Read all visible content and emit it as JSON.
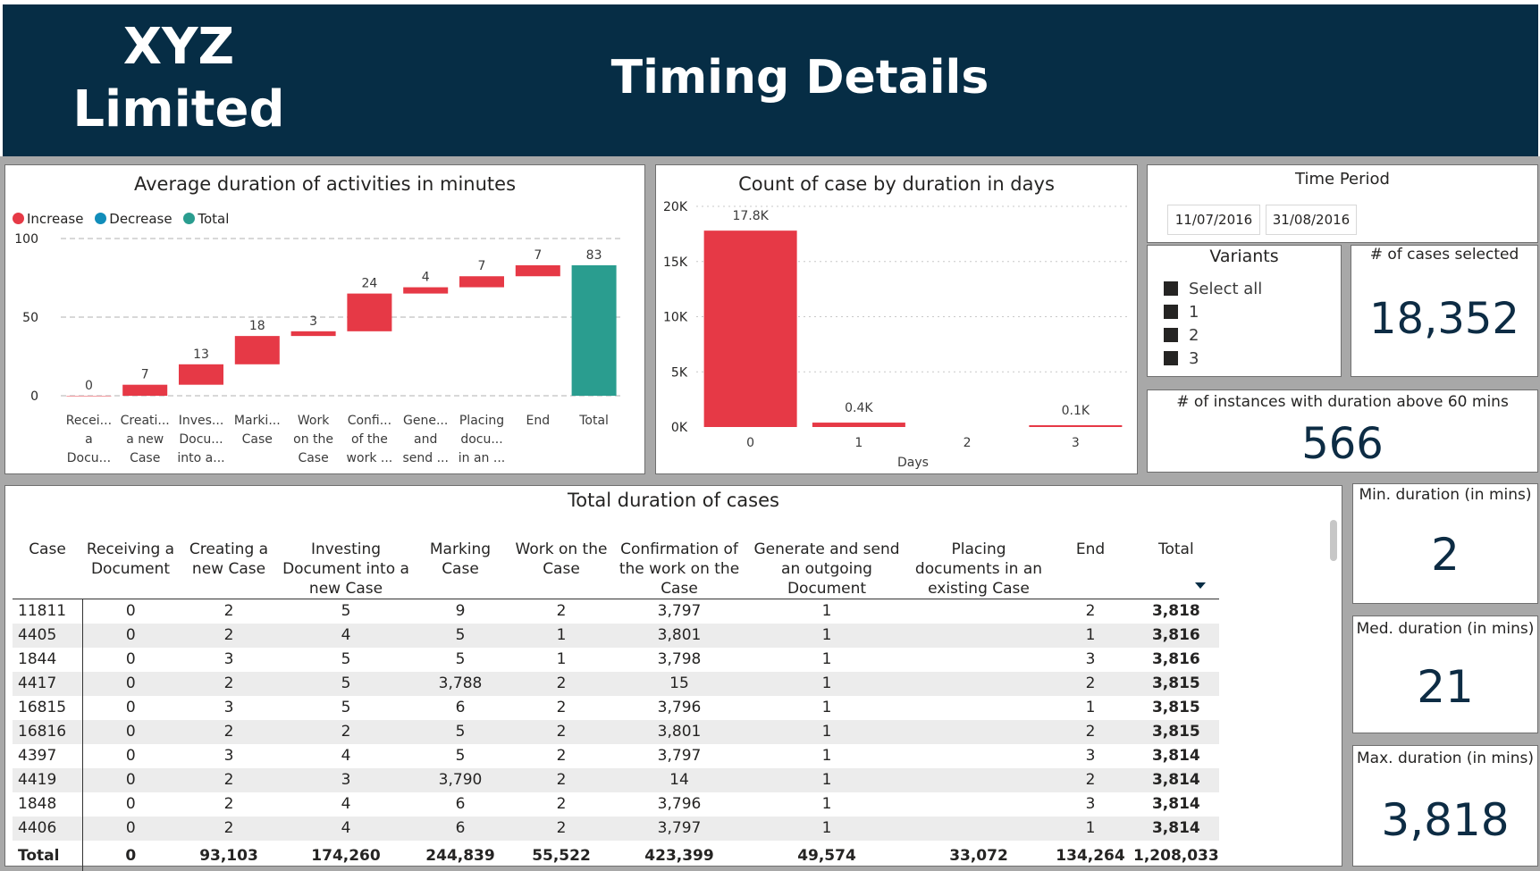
{
  "header": {
    "brand_line1": "XYZ",
    "brand_line2": "Limited",
    "title": "Timing Details"
  },
  "colors": {
    "increase": "#e63946",
    "decrease": "#118dba",
    "total": "#2a9d8f",
    "header_bg": "#062d45"
  },
  "waterfall": {
    "title": "Average duration of activities in minutes",
    "legend": [
      "Increase",
      "Decrease",
      "Total"
    ],
    "yticks": [
      "100",
      "50",
      "0"
    ]
  },
  "histogram": {
    "title": "Count of case by duration in days",
    "xlabel": "Days",
    "yticks": [
      "20K",
      "15K",
      "10K",
      "5K",
      "0K"
    ]
  },
  "chart_data": [
    {
      "type": "bar",
      "subtype": "waterfall",
      "title": "Average duration of activities in minutes",
      "categories": [
        [
          "Recei...",
          "a",
          "Docu..."
        ],
        [
          "Creati...",
          "a new",
          "Case"
        ],
        [
          "Inves...",
          "Docu...",
          "into a..."
        ],
        [
          "Marki...",
          "Case"
        ],
        [
          "Work",
          "on the",
          "Case"
        ],
        [
          "Confi...",
          "of the",
          "work ..."
        ],
        [
          "Gene...",
          "and",
          "send ..."
        ],
        [
          "Placing",
          "docu...",
          "in an ..."
        ],
        [
          "End"
        ],
        [
          "Total"
        ]
      ],
      "values": [
        0,
        7,
        13,
        18,
        3,
        24,
        4,
        7,
        7,
        83
      ],
      "value_labels": [
        "0",
        "7",
        "13",
        "18",
        "3",
        "24",
        "4",
        "7",
        "7",
        "83"
      ],
      "kinds": [
        "increase",
        "increase",
        "increase",
        "increase",
        "increase",
        "increase",
        "increase",
        "increase",
        "increase",
        "total"
      ],
      "ylim": [
        0,
        100
      ],
      "grid": true,
      "legend_position": "top-left"
    },
    {
      "type": "bar",
      "title": "Count of case by duration in days",
      "xlabel": "Days",
      "categories": [
        "0",
        "1",
        "2",
        "3"
      ],
      "values": [
        17800,
        400,
        0,
        100
      ],
      "value_labels": [
        "17.8K",
        "0.4K",
        "",
        "0.1K"
      ],
      "ylim": [
        0,
        20000
      ],
      "grid": true
    }
  ],
  "time_period": {
    "title": "Time Period",
    "start": "11/07/2016",
    "end": "31/08/2016"
  },
  "variants": {
    "title": "Variants",
    "items": [
      "Select all",
      "1",
      "2",
      "3"
    ]
  },
  "kpis": {
    "cases_selected": {
      "label": "# of cases selected",
      "value": "18,352"
    },
    "instances_above": {
      "label": "# of instances with duration above 60 mins",
      "value": "566"
    },
    "min": {
      "label": "Min. duration (in mins)",
      "value": "2"
    },
    "med": {
      "label": "Med. duration (in mins)",
      "value": "21"
    },
    "max": {
      "label": "Max. duration (in mins)",
      "value": "3,818"
    }
  },
  "table": {
    "title": "Total duration of cases",
    "columns": [
      "Case",
      "Receiving a Document",
      "Creating a new Case",
      "Investing Document into a new Case",
      "Marking Case",
      "Work on the Case",
      "Confirmation of the work on the Case",
      "Generate and send an outgoing Document",
      "Placing documents in an existing Case",
      "End",
      "Total"
    ],
    "rows": [
      [
        "11811",
        "0",
        "2",
        "5",
        "9",
        "2",
        "3,797",
        "1",
        "",
        "2",
        "3,818"
      ],
      [
        "4405",
        "0",
        "2",
        "4",
        "5",
        "1",
        "3,801",
        "1",
        "",
        "1",
        "3,816"
      ],
      [
        "1844",
        "0",
        "3",
        "5",
        "5",
        "1",
        "3,798",
        "1",
        "",
        "3",
        "3,816"
      ],
      [
        "4417",
        "0",
        "2",
        "5",
        "3,788",
        "2",
        "15",
        "1",
        "",
        "2",
        "3,815"
      ],
      [
        "16815",
        "0",
        "3",
        "5",
        "6",
        "2",
        "3,796",
        "1",
        "",
        "1",
        "3,815"
      ],
      [
        "16816",
        "0",
        "2",
        "2",
        "5",
        "2",
        "3,801",
        "1",
        "",
        "2",
        "3,815"
      ],
      [
        "4397",
        "0",
        "3",
        "4",
        "5",
        "2",
        "3,797",
        "1",
        "",
        "3",
        "3,814"
      ],
      [
        "4419",
        "0",
        "2",
        "3",
        "3,790",
        "2",
        "14",
        "1",
        "",
        "2",
        "3,814"
      ],
      [
        "1848",
        "0",
        "2",
        "4",
        "6",
        "2",
        "3,796",
        "1",
        "",
        "3",
        "3,814"
      ],
      [
        "4406",
        "0",
        "2",
        "4",
        "6",
        "2",
        "3,797",
        "1",
        "",
        "1",
        "3,814"
      ]
    ],
    "total": [
      "Total",
      "0",
      "93,103",
      "174,260",
      "244,839",
      "55,522",
      "423,399",
      "49,574",
      "33,072",
      "134,264",
      "1,208,033"
    ]
  }
}
